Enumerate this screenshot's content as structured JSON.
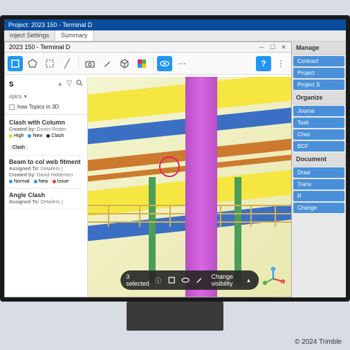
{
  "app": {
    "title": "Project: 2023 150 - Terminal D",
    "sub_window_title": "2023 150 - Terminal D"
  },
  "ribbon": {
    "tabs": [
      "roject Settings",
      "Summary"
    ]
  },
  "toolbar": {
    "icons": [
      "select",
      "polygon",
      "line",
      "slash",
      "camera",
      "brush",
      "box",
      "color",
      "eye",
      "more",
      "help",
      "dots"
    ]
  },
  "panel": {
    "header": "S",
    "subheader": "opics",
    "show_in_3d": "how Topics in 3D",
    "topics": [
      {
        "title": "Clash with Column",
        "created_by_label": "Created by:",
        "created_by": "Dustin Roden",
        "tags": [
          {
            "color": "#f5c518",
            "label": "High"
          },
          {
            "color": "#2196f3",
            "label": "New"
          },
          {
            "color": "#222",
            "label": "Clash"
          }
        ],
        "chip": "Clash"
      },
      {
        "title": "Beam to col web fitment",
        "assigned_to_label": "Assigned To:",
        "assigned_to": "Detailers |",
        "created_by_label": "Created by:",
        "created_by": "David Hiddemen",
        "tags": [
          {
            "color": "#2196f3",
            "label": "Normal"
          },
          {
            "color": "#2196f3",
            "label": "New"
          },
          {
            "color": "#e53935",
            "label": "Issue"
          }
        ]
      },
      {
        "title": "Angle Clash",
        "assigned_to_label": "Assigned To:",
        "assigned_to": "Detailers |"
      }
    ]
  },
  "floating_bar": {
    "selection": "3 selected",
    "change_visibility": "Change visibility"
  },
  "right_rail": {
    "sections": [
      {
        "title": "Manage",
        "items": [
          "Contract",
          "Project",
          "Project S"
        ]
      },
      {
        "title": "Organize",
        "items": [
          "Journa",
          "Task",
          "Chec",
          "BCF"
        ]
      },
      {
        "title": "Document",
        "items": [
          "Draw",
          "Trans",
          "R",
          "Change"
        ]
      }
    ]
  },
  "viewport": {
    "colors": {
      "yellow_beam": "#f5e642",
      "blue_beam": "#3b6fc4",
      "orange_beam": "#cc7a2e",
      "magenta_column": "#d966e3",
      "green_column": "#4a9e5a",
      "marker": "#e91e63"
    }
  },
  "copyright": "© 2024 Trimble"
}
